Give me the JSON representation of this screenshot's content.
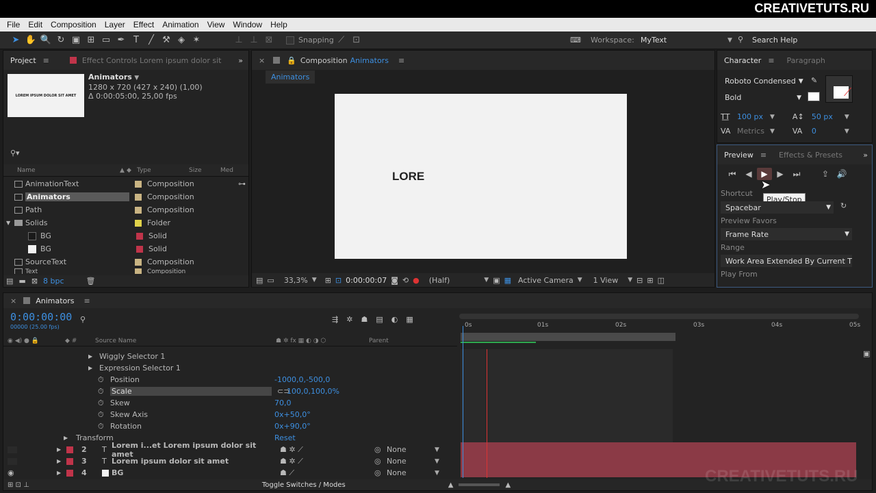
{
  "brand": "CREATIVETUTS.RU",
  "watermark": "CREATIVETUTS.RU",
  "menu": [
    "File",
    "Edit",
    "Composition",
    "Layer",
    "Effect",
    "Animation",
    "View",
    "Window",
    "Help"
  ],
  "toolbar": {
    "snapping": "Snapping",
    "workspace_label": "Workspace:",
    "workspace_value": "MyText",
    "search_help": "Search Help"
  },
  "project": {
    "tab": "Project",
    "effect_tab": "Effect Controls Lorem ipsum dolor sit",
    "thumb_text": "LOREM IPSUM DOLOR SIT AMET",
    "comp_name": "Animators",
    "comp_info1": "1280 x 720  (427 x 240) (1,00)",
    "comp_info2": "Δ 0:00:05:00, 25,00 fps",
    "columns": {
      "name": "Name",
      "type": "Type",
      "size": "Size",
      "media": "Med"
    },
    "items": [
      {
        "name": "AnimationText",
        "type": "Composition",
        "color": "#c9b483"
      },
      {
        "name": "Animators",
        "type": "Composition",
        "color": "#c9b483"
      },
      {
        "name": "Path",
        "type": "Composition",
        "color": "#c9b483"
      },
      {
        "name": "Solids",
        "type": "Folder",
        "color": "#e0d24a"
      },
      {
        "name": "BG",
        "type": "Solid",
        "color": "#c0344a"
      },
      {
        "name": "BG",
        "type": "Solid",
        "color": "#c0344a"
      },
      {
        "name": "SourceText",
        "type": "Composition",
        "color": "#c9b483"
      },
      {
        "name": "Text",
        "type": "Composition",
        "color": "#c9b483"
      }
    ],
    "bpc": "8 bpc"
  },
  "composition": {
    "tab_prefix": "Composition",
    "tab_name": "Animators",
    "subtab": "Animators",
    "canvas_text": "LORE",
    "zoom": "33,3%",
    "timecode": "0:00:00:07",
    "resolution": "(Half)",
    "camera": "Active Camera",
    "views": "1 View"
  },
  "character": {
    "tab": "Character",
    "para_tab": "Paragraph",
    "font": "Roboto Condensed",
    "style": "Bold",
    "size": "100 px",
    "leading": "50 px",
    "kerning": "Metrics",
    "tracking": "0"
  },
  "preview": {
    "tab": "Preview",
    "effects_tab": "Effects & Presets",
    "tooltip": "Play/Stop",
    "shortcut_label": "Shortcut",
    "shortcut_value": "Spacebar",
    "favors_label": "Preview Favors",
    "favors_value": "Frame Rate",
    "range_label": "Range",
    "range_value": "Work Area Extended By Current Ti",
    "playfrom_label": "Play From"
  },
  "timeline": {
    "tab": "Animators",
    "timecode": "0:00:00:00",
    "frames": "00000 (25.00 fps)",
    "col_source": "Source Name",
    "col_parent": "Parent",
    "ruler": [
      "0s",
      "01s",
      "02s",
      "03s",
      "04s",
      "05s"
    ],
    "toggle": "Toggle Switches / Modes",
    "props": [
      {
        "name": "Wiggly Selector 1",
        "value": "",
        "twirl": true
      },
      {
        "name": "Expression Selector 1",
        "value": "",
        "twirl": true
      },
      {
        "name": "Position",
        "value": "-1000,0,-500,0"
      },
      {
        "name": "Scale",
        "value": "100,0,100,0%",
        "selected": true
      },
      {
        "name": "Skew",
        "value": "70,0"
      },
      {
        "name": "Skew Axis",
        "value": "0x+50,0°"
      },
      {
        "name": "Rotation",
        "value": "0x+90,0°"
      }
    ],
    "transform": {
      "name": "Transform",
      "value": "Reset"
    },
    "layers": [
      {
        "num": "2",
        "name": "Lorem i...et Lorem ipsum dolor sit amet",
        "parent": "None",
        "type": "T"
      },
      {
        "num": "3",
        "name": "Lorem ipsum dolor sit amet",
        "parent": "None",
        "type": "T"
      },
      {
        "num": "4",
        "name": "BG",
        "parent": "None",
        "type": "solid"
      }
    ]
  }
}
